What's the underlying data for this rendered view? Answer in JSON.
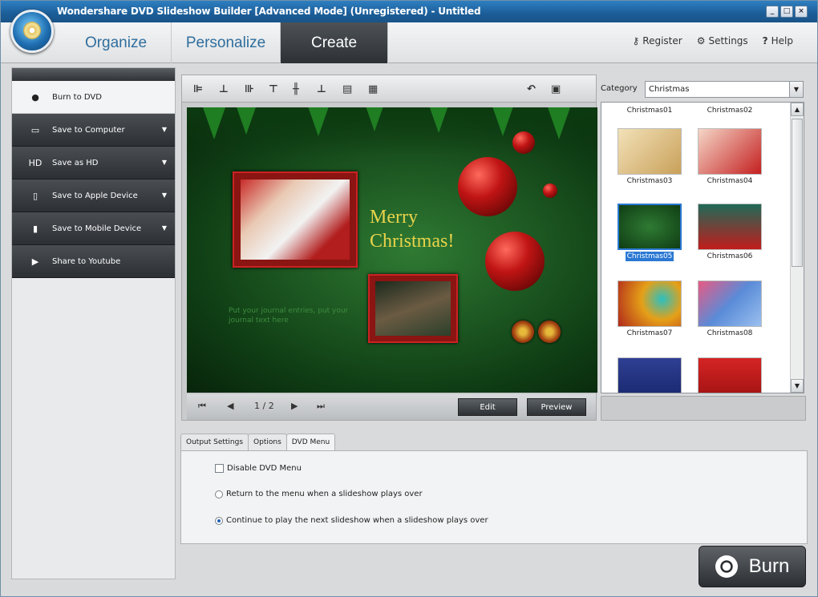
{
  "window": {
    "title": "Wondershare DVD Slideshow Builder [Advanced Mode] (Unregistered) - Untitled",
    "controls": [
      "_",
      "□",
      "×"
    ]
  },
  "tabs": [
    "Organize",
    "Personalize",
    "Create"
  ],
  "active_tab": "Create",
  "top_links": {
    "register": "Register",
    "settings": "Settings",
    "help": "Help"
  },
  "sidebar": {
    "items": [
      {
        "label": "Burn to DVD",
        "icon": "disc-icon"
      },
      {
        "label": "Save to Computer",
        "icon": "monitor-icon"
      },
      {
        "label": "Save as HD",
        "icon": "hd-icon"
      },
      {
        "label": "Save to Apple Device",
        "icon": "phone-icon"
      },
      {
        "label": "Save to Mobile Device",
        "icon": "mobile-icon"
      },
      {
        "label": "Share to Youtube",
        "icon": "youtube-icon"
      }
    ]
  },
  "canvas": {
    "merry": "Merry",
    "christmas": "Christmas!",
    "journal": "Put your journal entries, put your journal text here"
  },
  "nav": {
    "page": "1 / 2",
    "edit": "Edit",
    "preview": "Preview"
  },
  "category": {
    "label": "Category",
    "value": "Christmas"
  },
  "templates": [
    {
      "name": "Christmas01"
    },
    {
      "name": "Christmas02"
    },
    {
      "name": "Christmas03"
    },
    {
      "name": "Christmas04"
    },
    {
      "name": "Christmas05"
    },
    {
      "name": "Christmas06"
    },
    {
      "name": "Christmas07"
    },
    {
      "name": "Christmas08"
    }
  ],
  "settings_tabs": [
    "Output Settings",
    "Options",
    "DVD Menu"
  ],
  "dvd_menu": {
    "disable": "Disable DVD Menu",
    "return": "Return to the menu when a slideshow plays over",
    "continue": "Continue to play the next slideshow when a slideshow plays over"
  },
  "burn": "Burn"
}
